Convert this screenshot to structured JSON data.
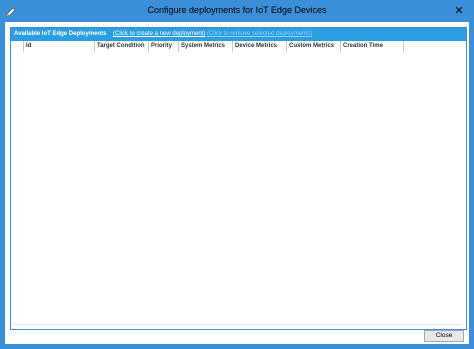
{
  "window": {
    "title": "Configure deployments for IoT Edge Devices",
    "close_glyph": "✕",
    "icon": "pencil-icon"
  },
  "deployments": {
    "header_title": "Available IoT Edge Deployments",
    "create_link": "(Click to create a new deployment)",
    "remove_link": "(Click to remove selected deployments)",
    "columns": [
      "",
      "Id",
      "Target Condition",
      "Priority",
      "System Metrics",
      "Device Metrics",
      "Custom Metrics",
      "Creation Time"
    ],
    "rows": []
  },
  "footer": {
    "close_label": "Close"
  },
  "colors": {
    "title_bar": "#3a8fd8",
    "group_header": "#2a9ee0",
    "disabled_link": "#8fd0f6"
  }
}
